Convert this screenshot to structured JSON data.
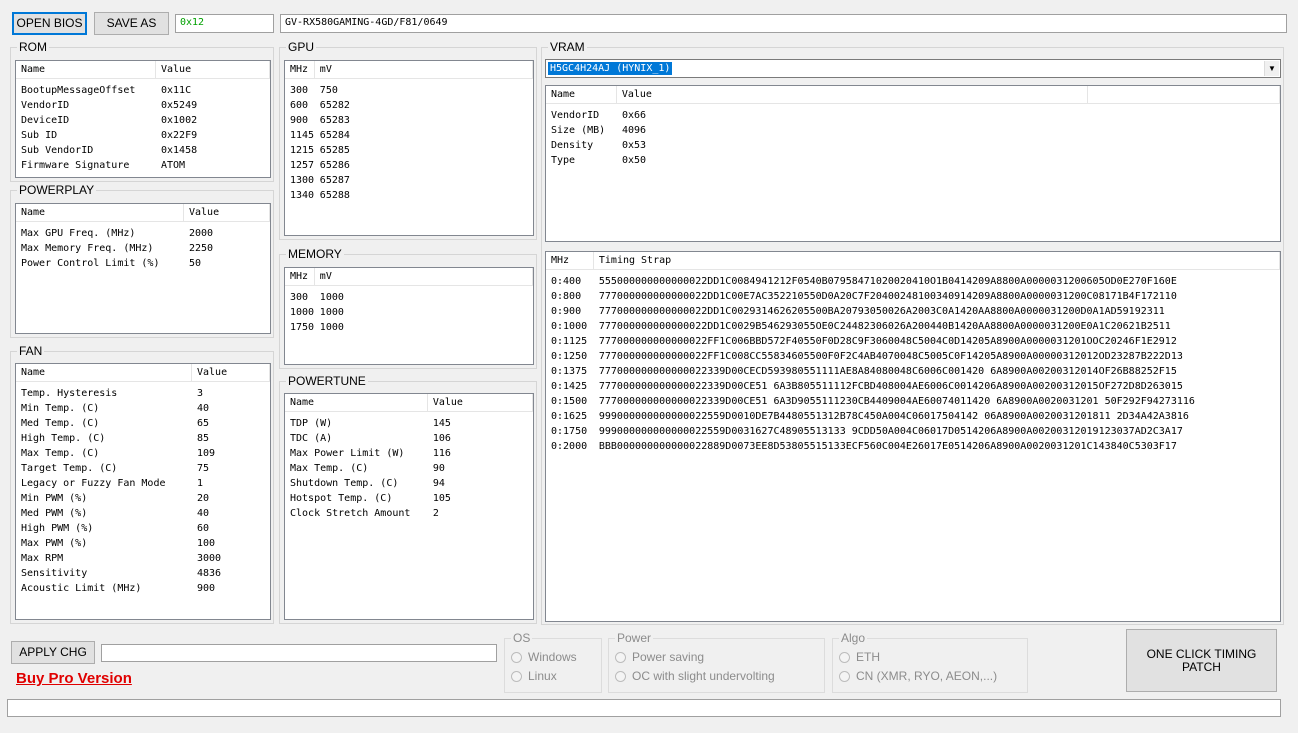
{
  "toolbar": {
    "open_bios": "OPEN BIOS",
    "save_as": "SAVE AS",
    "checksum": "0x12",
    "bios_name": "GV-RX580GAMING-4GD/F81/0649"
  },
  "rom": {
    "title": "ROM",
    "columns": [
      "Name",
      "Value"
    ],
    "rows": [
      [
        "BootupMessageOffset",
        "0x11C"
      ],
      [
        "VendorID",
        "0x5249"
      ],
      [
        "DeviceID",
        "0x1002"
      ],
      [
        "Sub ID",
        "0x22F9"
      ],
      [
        "Sub VendorID",
        "0x1458"
      ],
      [
        "Firmware Signature",
        "ATOM"
      ]
    ]
  },
  "powerplay": {
    "title": "POWERPLAY",
    "columns": [
      "Name",
      "Value"
    ],
    "rows": [
      [
        "Max GPU Freq. (MHz)",
        "2000"
      ],
      [
        "Max Memory Freq. (MHz)",
        "2250"
      ],
      [
        "Power Control Limit (%)",
        "50"
      ]
    ]
  },
  "fan": {
    "title": "FAN",
    "columns": [
      "Name",
      "Value"
    ],
    "rows": [
      [
        "Temp. Hysteresis",
        "3"
      ],
      [
        "Min Temp. (C)",
        "40"
      ],
      [
        "Med Temp. (C)",
        "65"
      ],
      [
        "High Temp. (C)",
        "85"
      ],
      [
        "Max Temp. (C)",
        "109"
      ],
      [
        "Target Temp. (C)",
        "75"
      ],
      [
        "Legacy or Fuzzy Fan Mode",
        "1"
      ],
      [
        "Min PWM (%)",
        "20"
      ],
      [
        "Med PWM (%)",
        "40"
      ],
      [
        "High PWM (%)",
        "60"
      ],
      [
        "Max PWM (%)",
        "100"
      ],
      [
        "Max RPM",
        "3000"
      ],
      [
        "Sensitivity",
        "4836"
      ],
      [
        "Acoustic Limit (MHz)",
        "900"
      ]
    ]
  },
  "gpu": {
    "title": "GPU",
    "columns": [
      "MHz",
      "mV"
    ],
    "rows": [
      [
        "300",
        "750"
      ],
      [
        "600",
        "65282"
      ],
      [
        "900",
        "65283"
      ],
      [
        "1145",
        "65284"
      ],
      [
        "1215",
        "65285"
      ],
      [
        "1257",
        "65286"
      ],
      [
        "1300",
        "65287"
      ],
      [
        "1340",
        "65288"
      ]
    ]
  },
  "memory": {
    "title": "MEMORY",
    "columns": [
      "MHz",
      "mV"
    ],
    "rows": [
      [
        "300",
        "1000"
      ],
      [
        "1000",
        "1000"
      ],
      [
        "1750",
        "1000"
      ]
    ]
  },
  "powertune": {
    "title": "POWERTUNE",
    "columns": [
      "Name",
      "Value"
    ],
    "rows": [
      [
        "TDP (W)",
        "145"
      ],
      [
        "TDC (A)",
        "106"
      ],
      [
        "Max Power Limit (W)",
        "116"
      ],
      [
        "Max Temp. (C)",
        "90"
      ],
      [
        "Shutdown Temp. (C)",
        "94"
      ],
      [
        "Hotspot Temp. (C)",
        "105"
      ],
      [
        "Clock Stretch Amount",
        "2"
      ]
    ]
  },
  "vram": {
    "title": "VRAM",
    "selected": "H5GC4H24AJ (HYNIX_1)",
    "columns": [
      "Name",
      "Value"
    ],
    "rows": [
      [
        "VendorID",
        "0x66"
      ],
      [
        "Size (MB)",
        "4096"
      ],
      [
        "Density",
        "0x53"
      ],
      [
        "Type",
        "0x50"
      ]
    ]
  },
  "timing": {
    "columns": [
      "MHz",
      "Timing Strap"
    ],
    "rows": [
      [
        "0:400",
        "555000000000000022DD1C0084941212F0540B07958471020020410O1B0414209A8800A0000031200605OD0E270F160E"
      ],
      [
        "0:800",
        "777000000000000022DD1C00E7AC352210550D0A20C7F20400248100340914209A8800A0000031200C08171B4F172110"
      ],
      [
        "0:900",
        "777000000000000022DD1C0029314626205500BA20793050026A2003C0A1420AA8800A0000031200D0A1AD59192311"
      ],
      [
        "0:1000",
        "777000000000000022DD1C0029B546293055OE0C24482306026A200440B1420AA8800A0000031200E0A1C20621B2511"
      ],
      [
        "0:1125",
        "777000000000000022FF1C006BBD572F40550F0D28C9F3060048C5004C0D14205A8900A0000031201OOC20246F1E2912"
      ],
      [
        "0:1250",
        "777000000000000022FF1C008CC55834605500F0F2C4AB4070048C5005C0F14205A8900A00000312012OD23287B222D13"
      ],
      [
        "0:1375",
        "777000000000000022339D00CECD593980551111AE8A84080048C6006C001420 6A8900A00200312014OF26B88252F15"
      ],
      [
        "0:1425",
        "777000000000000022339D00CE51 6A3B805511112FCBD408004AE6006C0014206A8900A00200312015OF272D8D263015"
      ],
      [
        "0:1500",
        "777000000000000022339D00CE51 6A3D9055111230CB4409004AE60074011420 6A8900A0020031201 50F292F94273116"
      ],
      [
        "0:1625",
        "999000000000000022559D0010DE7B4480551312B78C450A004C06017504142 06A8900A0020031201811 2D34A42A3816"
      ],
      [
        "0:1750",
        "999000000000000022559D0031627C48905513133 9CDD50A004C06017D0514206A8900A00200312019123037AD2C3A17"
      ],
      [
        "0:2000",
        "BBB000000000000022889D0073EE8D53805515133ECF560C004E26017E0514206A8900A0020031201C143840C5303F17"
      ]
    ]
  },
  "apply": {
    "label": "APPLY CHG",
    "input_value": ""
  },
  "buy_pro": "Buy Pro Version",
  "os": {
    "title": "OS",
    "options": [
      "Windows",
      "Linux"
    ]
  },
  "power": {
    "title": "Power",
    "options": [
      "Power saving",
      "OC with slight undervolting"
    ]
  },
  "algo": {
    "title": "Algo",
    "options": [
      "ETH",
      "CN (XMR, RYO, AEON,...)"
    ]
  },
  "one_click": {
    "line1": "ONE CLICK TIMING",
    "line2": "PATCH"
  },
  "status": ""
}
